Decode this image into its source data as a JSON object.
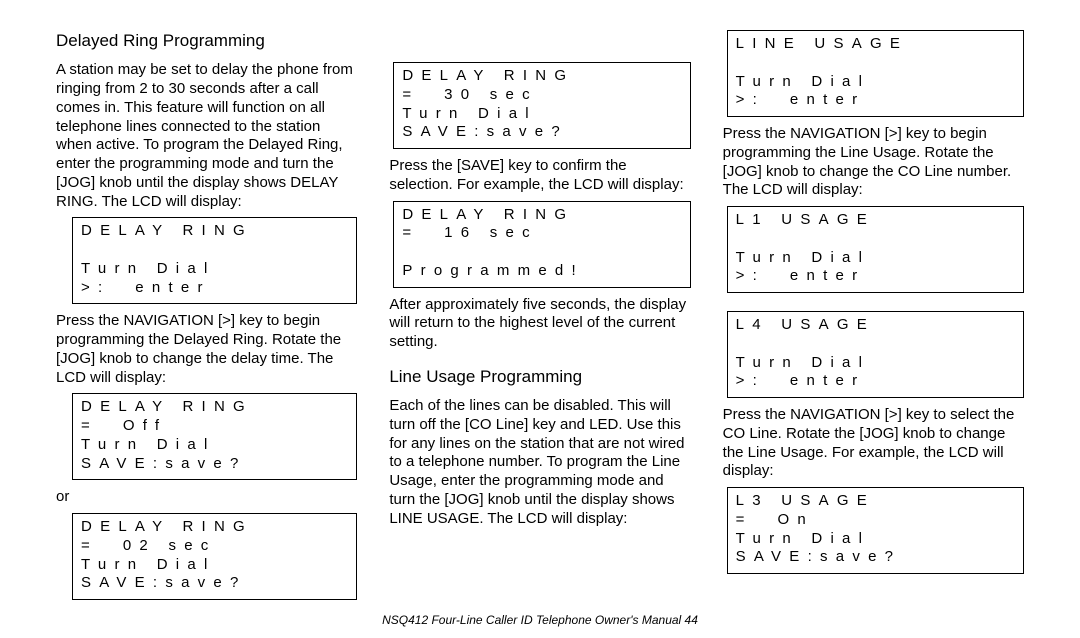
{
  "col1": {
    "h_delayed": "Delayed Ring Programming",
    "p1": "A station may be set to delay the phone from ringing from 2 to 30 seconds after a call comes in. This feature will function on all telephone lines connected to the station when active.  To program the Delayed Ring, enter the programming mode and turn the [JOG] knob until the display shows DELAY RING. The LCD will display:",
    "lcd1": "DELAY RING\n\nTurn Dial\n>:  enter",
    "p2": "Press the NAVIGATION [>] key to begin programming the Delayed Ring. Rotate the [JOG] knob to change the delay time. The LCD will display:",
    "lcd2": "DELAY RING\n=  Off\nTurn Dial\nSAVE:save?",
    "or": "or",
    "lcd3": "DELAY RING\n=  02 sec\nTurn Dial\nSAVE:save?"
  },
  "col2": {
    "lcd4": "DELAY RING\n=  30 sec\nTurn Dial\nSAVE:save?",
    "p3": "Press the [SAVE] key to confirm the selection. For example, the LCD will display:",
    "lcd5": "DELAY RING\n=  16 sec\n\nProgrammed!",
    "p4": "After approximately five seconds, the display will return to the highest level of the current setting.",
    "h_line": "Line Usage Programming",
    "p5": "Each of the lines can be disabled. This will turn off the [CO Line] key and LED. Use this for any lines on the station that are not wired to a telephone number. To program the Line Usage, enter the programming mode and turn the [JOG] knob until the display shows LINE USAGE. The LCD will display:"
  },
  "col3": {
    "lcd6": "LINE USAGE\n\nTurn Dial\n>:  enter",
    "p6": "Press the NAVIGATION [>] key to begin programming the Line Usage. Rotate the [JOG] knob to change the CO Line number. The LCD will display:",
    "lcd7": "L1 USAGE\n\nTurn Dial\n>:  enter",
    "lcd8": "L4 USAGE\n\nTurn Dial\n>:  enter",
    "p7": "Press the NAVIGATION [>] key to select the CO Line. Rotate the [JOG] knob to change the Line Usage. For example, the LCD will display:",
    "lcd9": "L3 USAGE\n=  On\nTurn Dial\nSAVE:save?"
  },
  "footer": "NSQ412 Four-Line Caller ID Telephone Owner's Manual    44"
}
